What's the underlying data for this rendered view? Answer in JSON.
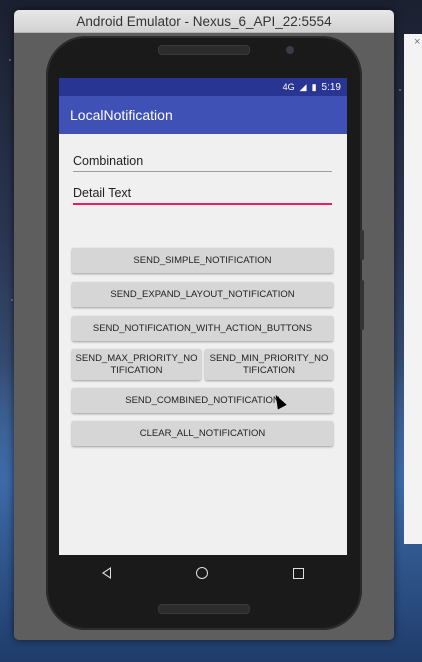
{
  "window": {
    "title": "Android Emulator - Nexus_6_API_22:5554"
  },
  "statusbar": {
    "network": "4G",
    "time": "5:19"
  },
  "app": {
    "title": "LocalNotification"
  },
  "fields": [
    {
      "value": "Combination"
    },
    {
      "value": "Detail Text"
    }
  ],
  "buttons": {
    "simple": "SEND_SIMPLE_NOTIFICATION",
    "expand": "SEND_EXPAND_LAYOUT_NOTIFICATION",
    "action": "SEND_NOTIFICATION_WITH_ACTION_BUTTONS",
    "max_priority": "SEND_MAX_PRIORITY_NO TIFICATION",
    "min_priority": "SEND_MIN_PRIORITY_NO TIFICATION",
    "combined": "SEND_COMBINED_NOTIFICATION",
    "clear_all": "CLEAR_ALL_NOTIFICATION"
  },
  "side_panel": {
    "close": "×"
  }
}
